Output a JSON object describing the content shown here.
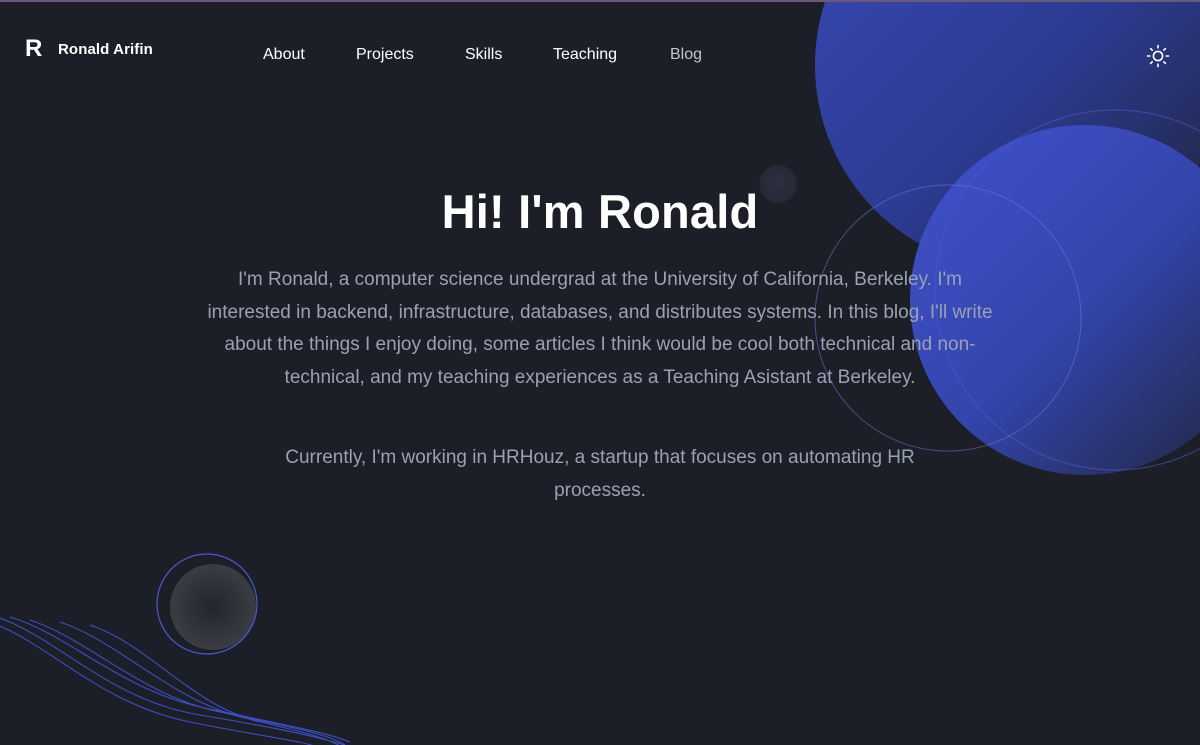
{
  "brand": {
    "mark": "R",
    "name": "Ronald Arifin"
  },
  "nav": {
    "about": "About",
    "projects": "Projects",
    "skills": "Skills",
    "teaching": "Teaching",
    "blog": "Blog"
  },
  "theme_toggle": {
    "icon": "sun-icon"
  },
  "hero": {
    "title": "Hi! I'm Ronald",
    "intro": "I'm Ronald, a computer science undergrad at the University of California, Berkeley. I'm interested in backend, infrastructure, databases, and distributes systems. In this blog, I'll write about the things I enjoy doing, some articles I think would be cool both technical and non-technical, and my teaching experiences as a Teaching Asistant at Berkeley.",
    "current": "Currently, I'm working in HRHouz, a startup that focuses on automating HR processes."
  },
  "colors": {
    "background": "#1c1f27",
    "accent": "#3d4fc4",
    "text_primary": "#ffffff",
    "text_secondary": "#9aa1b2"
  }
}
